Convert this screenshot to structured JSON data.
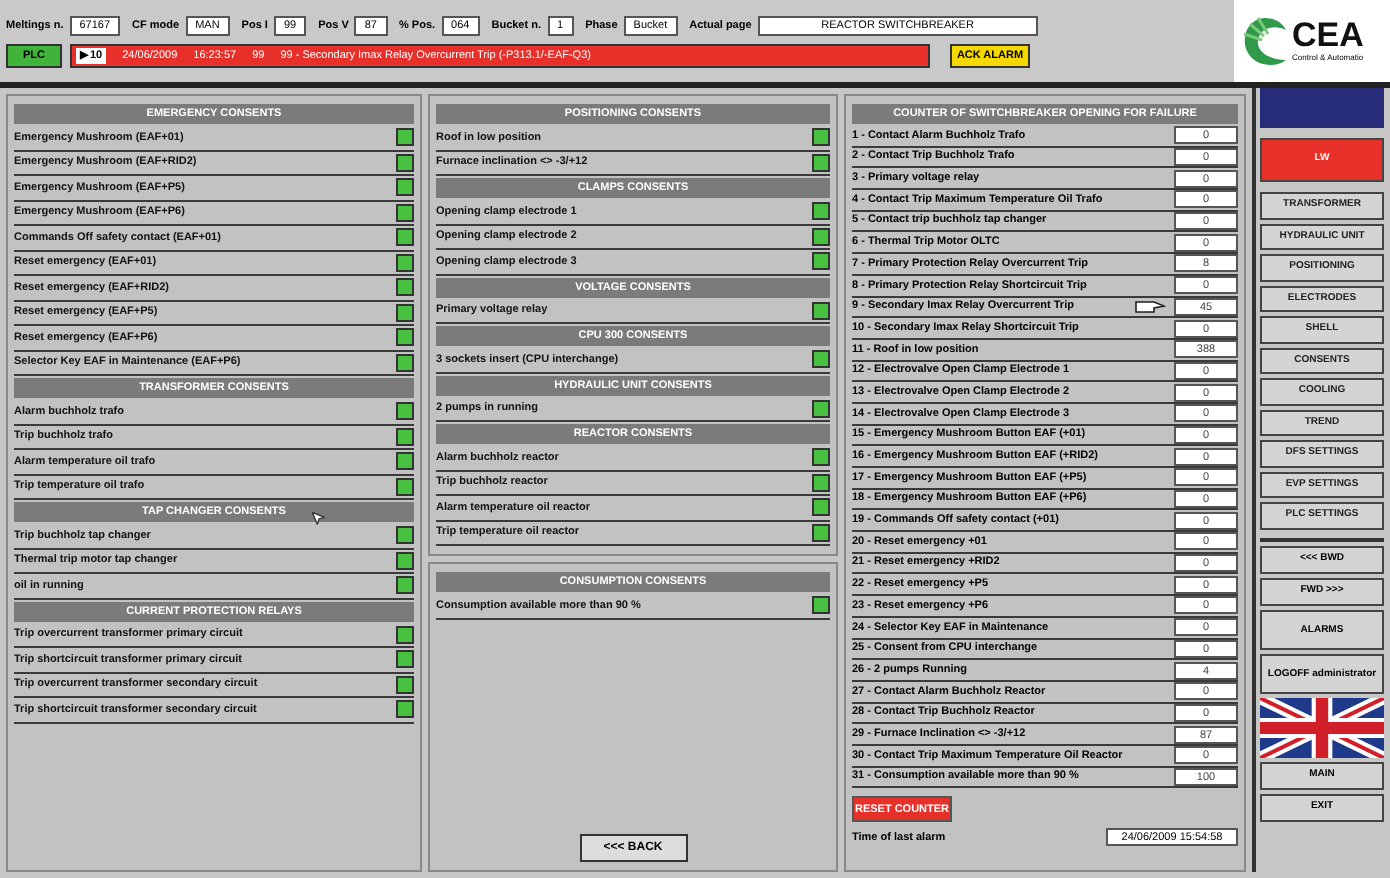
{
  "top_bar": {
    "fields": [
      {
        "label": "Meltings n.",
        "value": "67167"
      },
      {
        "label": "CF mode",
        "value": "MAN"
      },
      {
        "label": "Pos I",
        "value": "99"
      },
      {
        "label": "Pos V",
        "value": "87"
      },
      {
        "label": "% Pos.",
        "value": "064"
      },
      {
        "label": "Bucket n.",
        "value": "1"
      },
      {
        "label": "Phase",
        "value": "Bucket"
      },
      {
        "label": "Actual page",
        "value": "REACTOR SWITCHBREAKER"
      }
    ],
    "plc_button": "PLC",
    "alarm": {
      "index": "▶10",
      "date": "24/06/2009",
      "time": "16:23:57",
      "code": "99",
      "message": "99 - Secondary Imax Relay Overcurrent Trip (-P313.1/-EAF-Q3)"
    },
    "ack_button": "ACK ALARM"
  },
  "logo": {
    "name": "CEA",
    "tagline": "Control & Automatio"
  },
  "left_panel": [
    {
      "title": "EMERGENCY CONSENTS",
      "items": [
        {
          "label": "Emergency Mushroom (EAF+01)",
          "on": true
        },
        {
          "label": "Emergency Mushroom (EAF+RID2)",
          "on": true
        },
        {
          "label": "Emergency Mushroom (EAF+P5)",
          "on": true
        },
        {
          "label": "Emergency Mushroom (EAF+P6)",
          "on": true
        },
        {
          "label": "Commands Off safety contact (EAF+01)",
          "on": true
        },
        {
          "label": "Reset emergency (EAF+01)",
          "on": true
        },
        {
          "label": "Reset emergency (EAF+RID2)",
          "on": true
        },
        {
          "label": "Reset emergency (EAF+P5)",
          "on": true
        },
        {
          "label": "Reset emergency (EAF+P6)",
          "on": true
        },
        {
          "label": "Selector Key EAF in Maintenance (EAF+P6)",
          "on": true
        }
      ]
    },
    {
      "title": "TRANSFORMER CONSENTS",
      "items": [
        {
          "label": "Alarm buchholz trafo",
          "on": true
        },
        {
          "label": "Trip buchholz trafo",
          "on": true
        },
        {
          "label": "Alarm temperature oil trafo",
          "on": true
        },
        {
          "label": "Trip temperature oil trafo",
          "on": true
        }
      ]
    },
    {
      "title": "TAP CHANGER CONSENTS",
      "items": [
        {
          "label": "Trip buchholz tap changer",
          "on": true
        },
        {
          "label": "Thermal trip motor tap changer",
          "on": true
        },
        {
          "label": "oil in running",
          "on": true
        }
      ]
    },
    {
      "title": "CURRENT PROTECTION RELAYS",
      "items": [
        {
          "label": "Trip overcurrent transformer primary circuit",
          "on": true
        },
        {
          "label": "Trip shortcircuit transformer primary circuit",
          "on": true
        },
        {
          "label": "Trip overcurrent transformer secondary circuit",
          "on": true
        },
        {
          "label": "Trip shortcircuit transformer secondary circuit",
          "on": true
        }
      ]
    }
  ],
  "middle_panel": [
    {
      "title": "POSITIONING CONSENTS",
      "items": [
        {
          "label": "Roof in low position",
          "on": true
        },
        {
          "label": "Furnace inclination <> -3/+12",
          "on": true
        }
      ]
    },
    {
      "title": "CLAMPS CONSENTS",
      "items": [
        {
          "label": "Opening clamp electrode 1",
          "on": true
        },
        {
          "label": "Opening clamp electrode 2",
          "on": true
        },
        {
          "label": "Opening clamp electrode 3",
          "on": true
        }
      ]
    },
    {
      "title": "VOLTAGE CONSENTS",
      "items": [
        {
          "label": "Primary voltage relay",
          "on": true
        }
      ]
    },
    {
      "title": "CPU 300 CONSENTS",
      "items": [
        {
          "label": "3 sockets insert (CPU interchange)",
          "on": true
        }
      ]
    },
    {
      "title": "HYDRAULIC UNIT CONSENTS",
      "items": [
        {
          "label": "2 pumps in running",
          "on": true
        }
      ]
    },
    {
      "title": "REACTOR CONSENTS",
      "items": [
        {
          "label": "Alarm buchholz reactor",
          "on": true
        },
        {
          "label": "Trip buchholz reactor",
          "on": true
        },
        {
          "label": "Alarm temperature oil reactor",
          "on": true
        },
        {
          "label": "Trip temperature oil reactor",
          "on": true
        }
      ]
    }
  ],
  "consumption_panel": {
    "title": "CONSUMPTION CONSENTS",
    "items": [
      {
        "label": "Consumption available more than 90 %",
        "on": true
      }
    ]
  },
  "back_button": "<<< BACK",
  "counters": {
    "title": "COUNTER OF SWITCHBREAKER OPENING FOR FAILURE",
    "rows": [
      {
        "label": "1 - Contact Alarm Buchholz Trafo",
        "value": "0"
      },
      {
        "label": "2 - Contact Trip Buchholz Trafo",
        "value": "0"
      },
      {
        "label": "3 - Primary voltage relay",
        "value": "0"
      },
      {
        "label": "4 - Contact Trip Maximum Temperature Oil Trafo",
        "value": "0"
      },
      {
        "label": "5 - Contact trip buchholz tap changer",
        "value": "0"
      },
      {
        "label": "6 - Thermal Trip Motor OLTC",
        "value": "0"
      },
      {
        "label": "7 - Primary Protection Relay Overcurrent Trip",
        "value": "8"
      },
      {
        "label": "8 - Primary Protection Relay Shortcircuit Trip",
        "value": "0"
      },
      {
        "label": "9 - Secondary Imax Relay Overcurrent Trip",
        "value": "45",
        "pointer": true
      },
      {
        "label": "10 - Secondary Imax Relay Shortcircuit Trip",
        "value": "0"
      },
      {
        "label": "11 - Roof in low position",
        "value": "388"
      },
      {
        "label": "12 - Electrovalve Open Clamp Electrode 1",
        "value": "0"
      },
      {
        "label": "13 - Electrovalve Open Clamp Electrode 2",
        "value": "0"
      },
      {
        "label": "14 - Electrovalve Open Clamp Electrode 3",
        "value": "0"
      },
      {
        "label": "15 - Emergency Mushroom Button EAF (+01)",
        "value": "0"
      },
      {
        "label": "16 - Emergency Mushroom Button EAF (+RID2)",
        "value": "0"
      },
      {
        "label": "17 - Emergency Mushroom Button EAF (+P5)",
        "value": "0"
      },
      {
        "label": "18 - Emergency Mushroom Button EAF (+P6)",
        "value": "0"
      },
      {
        "label": "19 - Commands Off safety contact (+01)",
        "value": "0"
      },
      {
        "label": "20 - Reset emergency +01",
        "value": "0"
      },
      {
        "label": "21 - Reset emergency +RID2",
        "value": "0"
      },
      {
        "label": "22 - Reset emergency +P5",
        "value": "0"
      },
      {
        "label": "23 - Reset emergency +P6",
        "value": "0"
      },
      {
        "label": "24 - Selector Key EAF in Maintenance",
        "value": "0"
      },
      {
        "label": "25 - Consent from CPU interchange",
        "value": "0"
      },
      {
        "label": "26 - 2 pumps Running",
        "value": "4"
      },
      {
        "label": "27 - Contact Alarm Buchholz Reactor",
        "value": "0"
      },
      {
        "label": "28 - Contact Trip Buchholz Reactor",
        "value": "0"
      },
      {
        "label": "29 - Furnace Inclination <> -3/+12",
        "value": "87"
      },
      {
        "label": "30 - Contact Trip Maximum Temperature Oil Reactor",
        "value": "0"
      },
      {
        "label": "31 - Consumption available more than 90 %",
        "value": "100"
      }
    ],
    "reset_button": "RESET COUNTER",
    "last_alarm_label": "Time of last alarm",
    "last_alarm_value": "24/06/2009 15:54:58"
  },
  "nav": [
    {
      "label": "LW",
      "selected": true
    },
    {
      "label": "TRANSFORMER",
      "selected": false
    },
    {
      "label": "HYDRAULIC UNIT",
      "selected": false
    },
    {
      "label": "POSITIONING",
      "selected": false
    },
    {
      "label": "ELECTRODES",
      "selected": false
    },
    {
      "label": "SHELL",
      "selected": false
    },
    {
      "label": "CONSENTS",
      "selected": false
    },
    {
      "label": "COOLING",
      "selected": false
    },
    {
      "label": "TREND",
      "selected": false
    },
    {
      "label": "DFS SETTINGS",
      "selected": false
    },
    {
      "label": "EVP SETTINGS",
      "selected": false
    },
    {
      "label": "PLC SETTINGS",
      "selected": false
    }
  ],
  "nav_bottom": [
    {
      "label": "<<< BWD",
      "kind": "small"
    },
    {
      "label": "FWD >>>",
      "kind": "small"
    },
    {
      "label": "ALARMS",
      "kind": "large"
    },
    {
      "label": "LOGOFF administrator",
      "kind": "large"
    },
    {
      "kind": "flag"
    },
    {
      "label": "MAIN",
      "kind": "small"
    },
    {
      "label": "EXIT",
      "kind": "small"
    }
  ]
}
